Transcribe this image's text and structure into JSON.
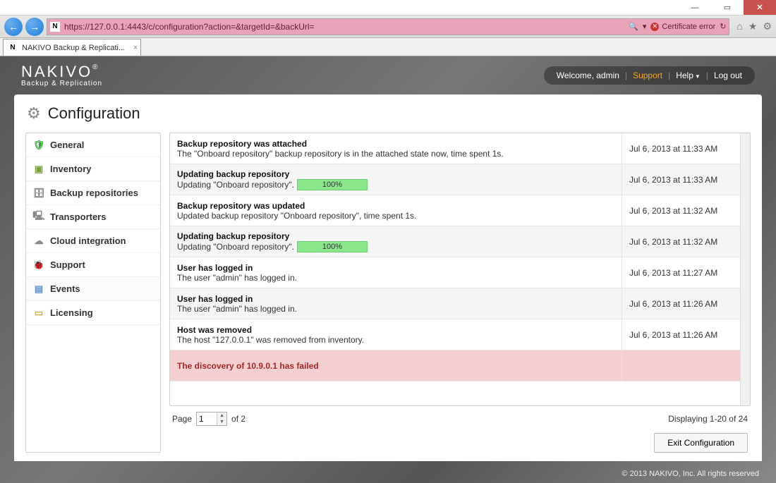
{
  "window": {
    "minimize": "—",
    "maximize": "▭",
    "close": "✕"
  },
  "browser": {
    "url": "https://127.0.0.1:4443/c/configuration?action=&targetId=&backUrl=",
    "favicon_letter": "N",
    "search_icon": "🔍",
    "cert_error": "Certificate error",
    "refresh": "↻",
    "tab_title": "NAKIVO Backup & Replicati..."
  },
  "logo": {
    "main": "NAKIVO",
    "reg": "®",
    "sub": "Backup & Replication"
  },
  "userbar": {
    "welcome": "Welcome, admin",
    "support": "Support",
    "help": "Help",
    "logout": "Log out"
  },
  "page": {
    "title": "Configuration"
  },
  "sidebar": {
    "items": [
      {
        "label": "General",
        "icon": "🛡",
        "color": "#3aa63a"
      },
      {
        "label": "Inventory",
        "icon": "▣",
        "color": "#7aa23a"
      },
      {
        "label": "Backup repositories",
        "icon": "🗄",
        "color": "#888"
      },
      {
        "label": "Transporters",
        "icon": "🖳",
        "color": "#888"
      },
      {
        "label": "Cloud integration",
        "icon": "☁",
        "color": "#888"
      },
      {
        "label": "Support",
        "icon": "🐞",
        "color": "#3aa63a"
      },
      {
        "label": "Events",
        "icon": "▤",
        "color": "#5a8fce",
        "active": true
      },
      {
        "label": "Licensing",
        "icon": "▭",
        "color": "#d8a93a"
      }
    ]
  },
  "events": [
    {
      "title": "Backup repository was attached",
      "desc": "The \"Onboard repository\" backup repository is in the attached state now, time spent 1s.",
      "time": "Jul 6, 2013 at 11:33 AM",
      "alt": false
    },
    {
      "title": "Updating backup repository",
      "desc": "Updating \"Onboard repository\".",
      "progress": "100%",
      "time": "Jul 6, 2013 at 11:33 AM",
      "alt": true
    },
    {
      "title": "Backup repository was updated",
      "desc": "Updated backup repository \"Onboard repository\", time spent 1s.",
      "time": "Jul 6, 2013 at 11:32 AM",
      "alt": false
    },
    {
      "title": "Updating backup repository",
      "desc": "Updating \"Onboard repository\".",
      "progress": "100%",
      "time": "Jul 6, 2013 at 11:32 AM",
      "alt": true
    },
    {
      "title": "User has logged in",
      "desc": "The user \"admin\" has logged in.",
      "time": "Jul 6, 2013 at 11:27 AM",
      "alt": false
    },
    {
      "title": "User has logged in",
      "desc": "The user \"admin\" has logged in.",
      "time": "Jul 6, 2013 at 11:26 AM",
      "alt": true
    },
    {
      "title": "Host was removed",
      "desc": "The host \"127.0.0.1\" was removed from inventory.",
      "time": "Jul 6, 2013 at 11:26 AM",
      "alt": false
    },
    {
      "title": "The discovery of 10.9.0.1 has failed",
      "desc": "",
      "time": "",
      "alt": true,
      "error": true
    }
  ],
  "pager": {
    "page_label": "Page",
    "page_value": "1",
    "of_label": "of 2",
    "displaying": "Displaying 1-20 of 24"
  },
  "buttons": {
    "exit": "Exit Configuration"
  },
  "footer": "© 2013 NAKIVO, Inc. All rights reserved"
}
